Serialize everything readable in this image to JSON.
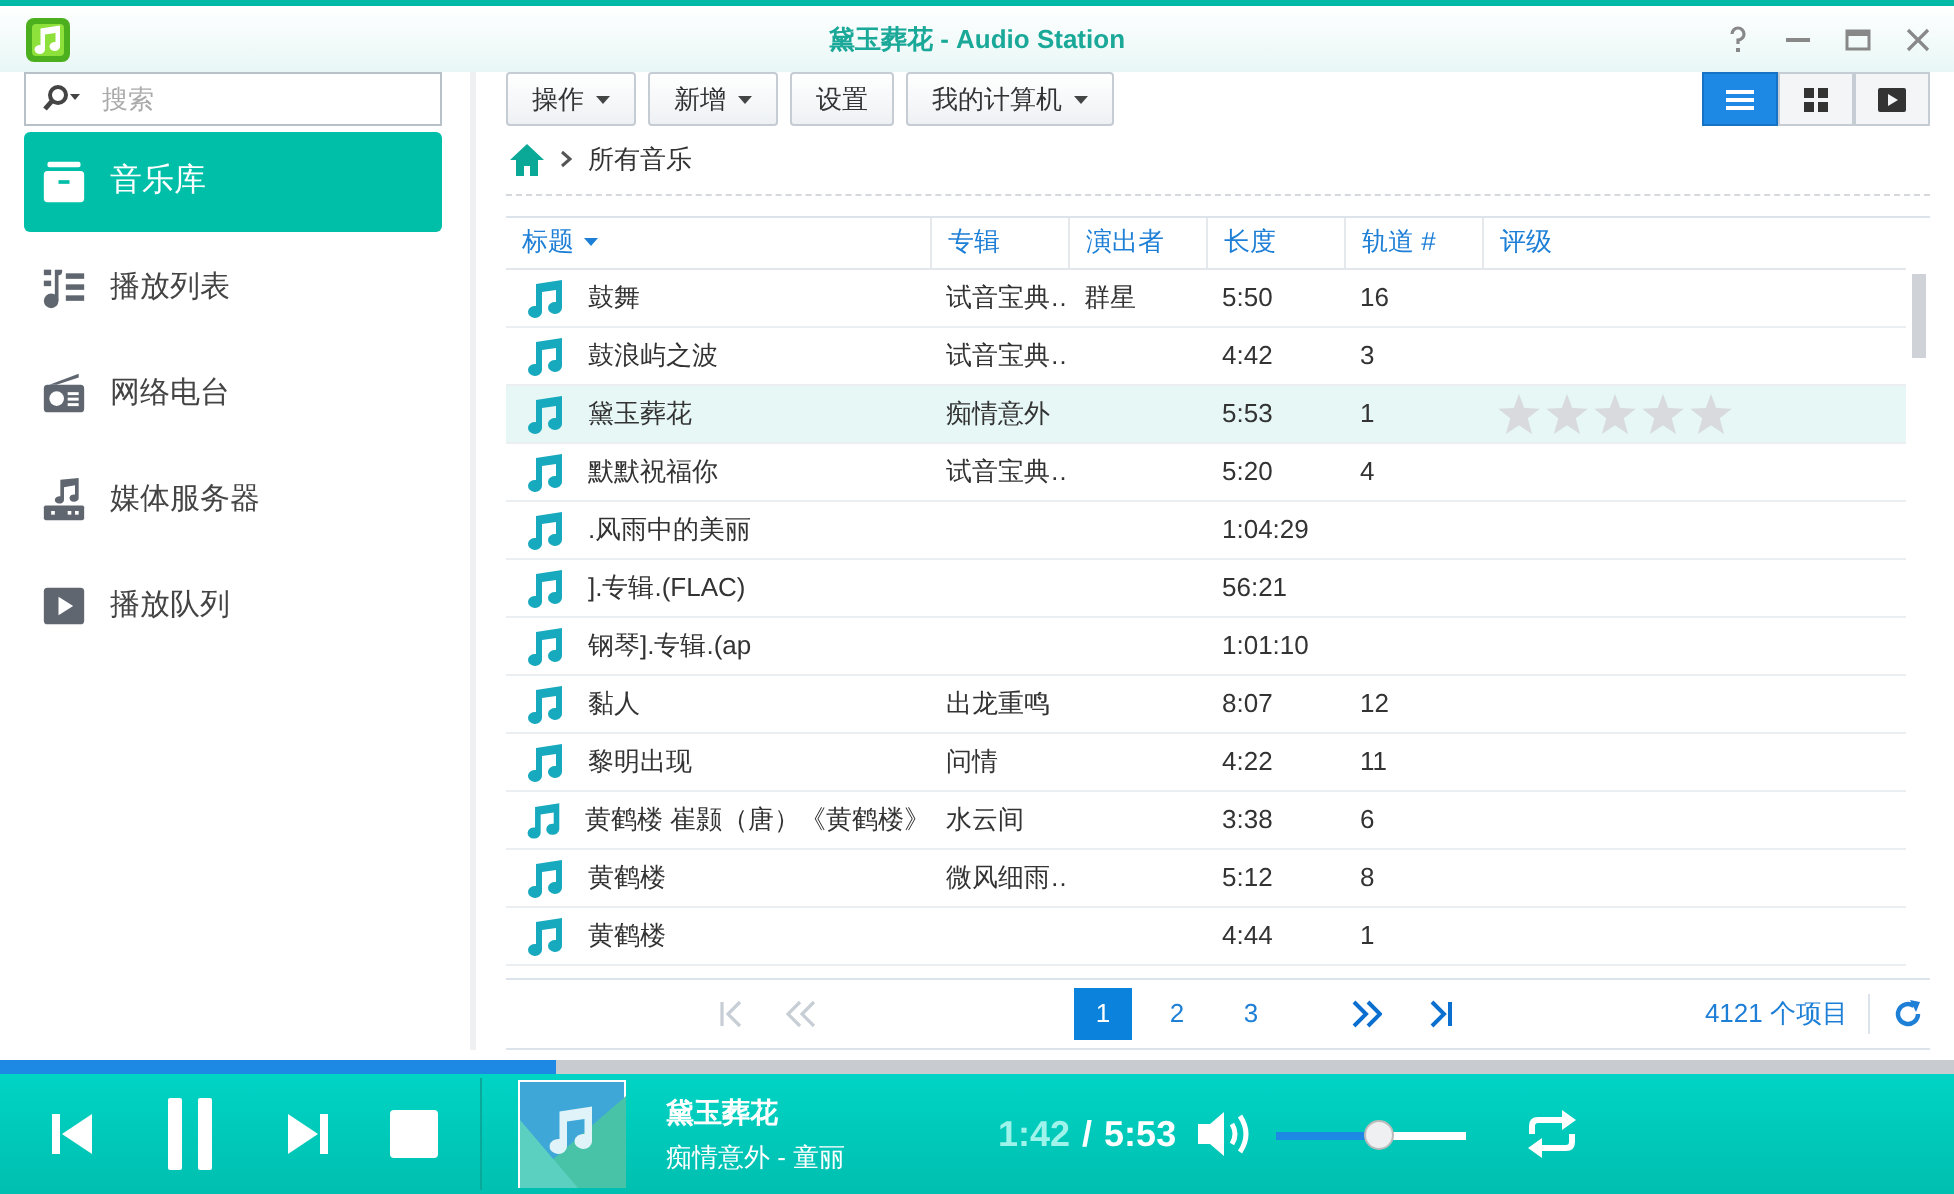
{
  "window": {
    "title": "黛玉葬花 - Audio Station"
  },
  "search": {
    "placeholder": "搜索"
  },
  "sidebar": {
    "items": [
      {
        "label": "音乐库",
        "kind": "library",
        "selected": true
      },
      {
        "label": "播放列表",
        "kind": "playlist",
        "selected": false
      },
      {
        "label": "网络电台",
        "kind": "radio",
        "selected": false
      },
      {
        "label": "媒体服务器",
        "kind": "server",
        "selected": false
      },
      {
        "label": "播放队列",
        "kind": "queue",
        "selected": false
      }
    ]
  },
  "toolbar": {
    "buttons": [
      {
        "label": "操作",
        "dropdown": true
      },
      {
        "label": "新增",
        "dropdown": true
      },
      {
        "label": "设置",
        "dropdown": false
      },
      {
        "label": "我的计算机",
        "dropdown": true
      }
    ],
    "views": [
      {
        "kind": "list",
        "selected": true
      },
      {
        "kind": "grid",
        "selected": false
      },
      {
        "kind": "player",
        "selected": false
      }
    ]
  },
  "breadcrumb": {
    "path": "所有音乐"
  },
  "table": {
    "columns": [
      "标题",
      "专辑",
      "演出者",
      "长度",
      "轨道 #",
      "评级"
    ],
    "rows": [
      {
        "title": "鼓舞",
        "album": "试音宝典…",
        "artist": "群星",
        "length": "5:50",
        "track": "16",
        "selected": false
      },
      {
        "title": "鼓浪屿之波",
        "album": "试音宝典…",
        "length": "4:42",
        "track": "3",
        "selected": false
      },
      {
        "title": "黛玉葬花",
        "album": "痴情意外",
        "length": "5:53",
        "track": "1",
        "selected": true,
        "stars": 0
      },
      {
        "title": "默默祝福你",
        "album": "试音宝典…",
        "length": "5:20",
        "track": "4",
        "selected": false
      },
      {
        "title": ".风雨中的美丽",
        "length": "1:04:29",
        "selected": false
      },
      {
        "title": "].专辑.(FLAC)",
        "length": "56:21",
        "selected": false
      },
      {
        "title": "钢琴].专辑.(ap",
        "length": "1:01:10",
        "selected": false
      },
      {
        "title": "黏人",
        "album": "出龙重鸣",
        "length": "8:07",
        "track": "12",
        "selected": false
      },
      {
        "title": "黎明出现",
        "album": "问情",
        "length": "4:22",
        "track": "11",
        "selected": false
      },
      {
        "title": "黄鹤楼 崔颢（唐）《黄鹤楼》",
        "album": "水云间",
        "length": "3:38",
        "track": "6",
        "selected": false
      },
      {
        "title": "黄鹤楼",
        "album": "微风细雨…",
        "length": "5:12",
        "track": "8",
        "selected": false
      },
      {
        "title": "黄鹤楼",
        "length": "4:44",
        "track": "1",
        "selected": false
      }
    ]
  },
  "pagination": {
    "pages": [
      {
        "label": "1",
        "selected": true
      },
      {
        "label": "2",
        "selected": false
      },
      {
        "label": "3",
        "selected": false
      }
    ],
    "count": "4121 个项目"
  },
  "player": {
    "progress": {
      "level": 0.285
    },
    "title": "黛玉葬花",
    "subtitle": "痴情意外 - 童丽",
    "elapsed": "1:42",
    "separator": "/",
    "duration": "5:53",
    "playing": true,
    "volume": {
      "level": 0.53
    }
  }
}
